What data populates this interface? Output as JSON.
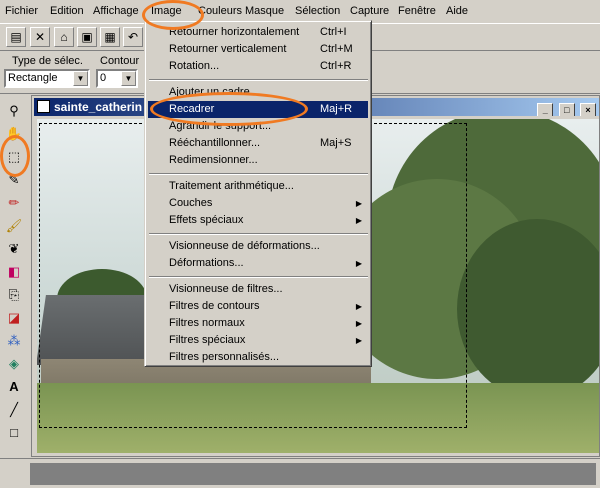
{
  "menubar": {
    "items": [
      "Fichier",
      "Edition",
      "Affichage",
      "Image",
      "Couleurs",
      "Masque",
      "Sélection",
      "Capture",
      "Fenêtre",
      "Aide"
    ]
  },
  "options": {
    "selection_type_label": "Type de sélec.",
    "selection_type_value": "Rectangle",
    "contour_label": "Contour",
    "contour_value": "0"
  },
  "document": {
    "title": "sainte_catherin"
  },
  "image_menu": {
    "items": [
      {
        "label": "Retourner horizontalement",
        "shortcut": "Ctrl+I"
      },
      {
        "label": "Retourner verticalement",
        "shortcut": "Ctrl+M"
      },
      {
        "label": "Rotation...",
        "shortcut": "Ctrl+R"
      },
      {
        "label": "Ajouter un cadre..."
      },
      {
        "label": "Recadrer",
        "shortcut": "Maj+R",
        "selected": true
      },
      {
        "label": "Agrandir le support..."
      },
      {
        "label": "Rééchantillonner...",
        "shortcut": "Maj+S"
      },
      {
        "label": "Redimensionner..."
      },
      {
        "label": "Traitement arithmétique..."
      },
      {
        "label": "Couches"
      },
      {
        "label": "Effets spéciaux"
      },
      {
        "label": "Visionneuse de déformations..."
      },
      {
        "label": "Déformations..."
      },
      {
        "label": "Visionneuse de filtres..."
      },
      {
        "label": "Filtres de contours"
      },
      {
        "label": "Filtres normaux"
      },
      {
        "label": "Filtres spéciaux"
      },
      {
        "label": "Filtres personnalisés..."
      }
    ]
  },
  "icons": {
    "toolbar": [
      "new-icon",
      "close-icon",
      "open-icon",
      "save-icon",
      "print-icon",
      "undo-icon"
    ],
    "tools": [
      "zoom-icon",
      "hand-icon",
      "selection-rect-icon",
      "eyedropper-icon",
      "pencil-icon",
      "brush-icon",
      "airbrush-icon",
      "fill-icon",
      "clone-icon",
      "eraser-icon",
      "spray-icon",
      "flood-fill-icon",
      "text-icon",
      "line-icon",
      "rectangle-icon"
    ]
  },
  "colors": {
    "accent": "#0a246a",
    "annotation": "#f07a22"
  }
}
